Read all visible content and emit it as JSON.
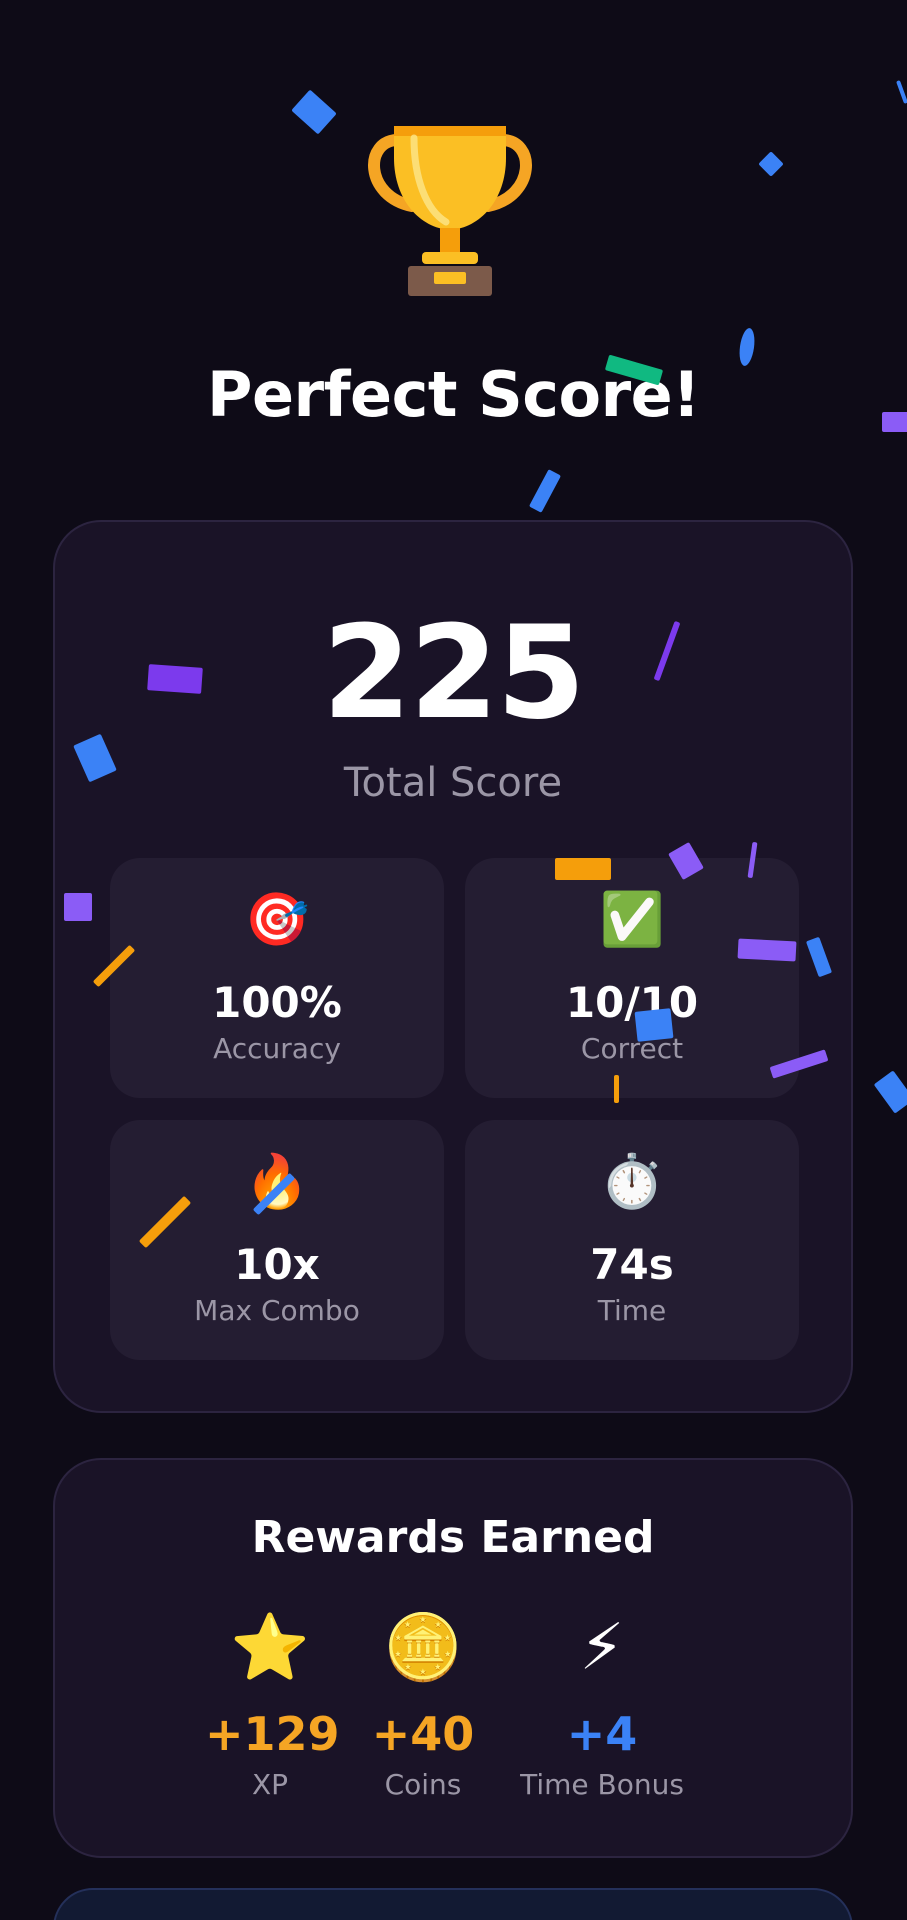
{
  "headline": "Perfect Score!",
  "score": {
    "value": "225",
    "label": "Total Score"
  },
  "stats": [
    {
      "icon": "🎯",
      "icon_name": "target-icon",
      "value": "100%",
      "label": "Accuracy"
    },
    {
      "icon": "✅",
      "icon_name": "check-icon",
      "value": "10/10",
      "label": "Correct"
    },
    {
      "icon": "🔥",
      "icon_name": "fire-icon",
      "value": "10x",
      "label": "Max Combo"
    },
    {
      "icon": "⏱️",
      "icon_name": "stopwatch-icon",
      "value": "74s",
      "label": "Time"
    }
  ],
  "rewards": {
    "title": "Rewards Earned",
    "items": [
      {
        "icon": "⭐",
        "icon_name": "star-icon",
        "value": "+129",
        "label": "XP",
        "color": "#f5a524"
      },
      {
        "icon": "🪙",
        "icon_name": "coin-icon",
        "value": "+40",
        "label": "Coins",
        "color": "#f5a524"
      },
      {
        "icon": "⚡",
        "icon_name": "lightning-icon",
        "value": "+4",
        "label": "Time Bonus",
        "color": "#3b82f6"
      }
    ]
  },
  "colors": {
    "background": "#0e0b17",
    "card": "#1a1327",
    "tile": "#241d32",
    "accent_orange": "#f5a524",
    "accent_blue": "#3b82f6",
    "accent_purple": "#8b5cf6",
    "accent_green": "#10b981",
    "muted_text": "#9b96a6"
  },
  "trophy_icon": "trophy-icon"
}
